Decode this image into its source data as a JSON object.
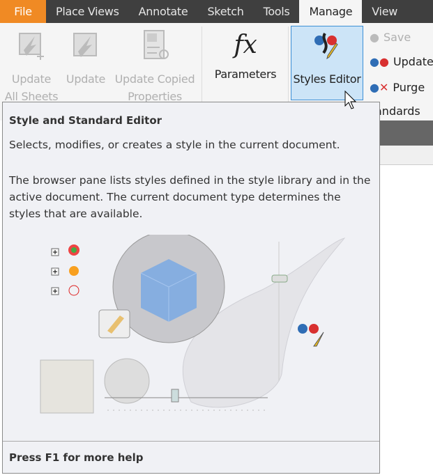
{
  "tabs": [
    "File",
    "Place Views",
    "Annotate",
    "Sketch",
    "Tools",
    "Manage",
    "View"
  ],
  "ribbon": {
    "update_all_1": "Update",
    "update_all_2": "All Sheets",
    "update": "Update",
    "update_copied_1": "Update Copied",
    "update_copied_2": "Properties",
    "parameters": "Parameters",
    "styles_editor": "Styles Editor",
    "save": "Save",
    "update_small": "Update",
    "purge": "Purge",
    "standards_label": "andards"
  },
  "tooltip": {
    "title": "Style and Standard Editor",
    "summary": "Selects, modifies, or creates a style in the current document.",
    "description": "The browser pane lists styles defined in the style library and in the active document. The current document type determines the styles that are available.",
    "help": "Press F1 for more help"
  }
}
